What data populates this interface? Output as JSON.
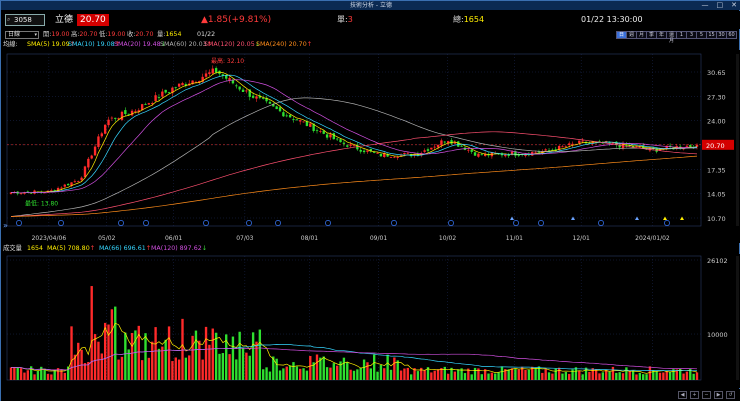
{
  "window": {
    "title": "技術分析 - 立德",
    "controls": [
      "—",
      "□",
      "✕"
    ]
  },
  "header": {
    "code": "3058",
    "name": "立德",
    "price": "20.70",
    "change": "▲1.85(+9.81%)",
    "unit_label": "單:",
    "unit_value": "3",
    "total_label": "總:",
    "total_value": "1654",
    "datetime": "01/22 13:30:00"
  },
  "ohlc": {
    "period": "日線",
    "open_label": "開:",
    "open": "19.00",
    "high_label": "高:",
    "high": "20.70",
    "low_label": "低:",
    "low": "19.00",
    "close_label": "收:",
    "close": "20.70",
    "vol_label": "量:",
    "vol": "1654",
    "date": "01/22"
  },
  "period_buttons": [
    "日",
    "週",
    "月",
    "季",
    "年",
    "還月",
    "1",
    "3",
    "5",
    "15",
    "30",
    "60"
  ],
  "ma_legend": {
    "label": "均線:",
    "items": [
      {
        "text": "SMA(5) 19.09",
        "arrow": "↑",
        "color": "#ffee00"
      },
      {
        "text": "SMA(10) 19.08",
        "arrow": "↑",
        "color": "#36d6ff"
      },
      {
        "text": "SMA(20) 19.48",
        "arrow": "↓",
        "color": "#d04fe0"
      },
      {
        "text": "SMA(60) 20.03",
        "arrow": "↑",
        "color": "#b0b0b0"
      },
      {
        "text": "SMA(120) 20.05",
        "arrow": "↓",
        "color": "#ff5070"
      },
      {
        "text": "SMA(240) 20.70",
        "arrow": "↑",
        "color": "#ff8c1a"
      }
    ]
  },
  "vol_legend": {
    "label": "成交量",
    "value": "1654",
    "items": [
      {
        "text": "MA(5) 708.80",
        "arrow": "↑",
        "color": "#ffee00"
      },
      {
        "text": "MA(66) 696.61",
        "arrow": "↑",
        "color": "#36d6ff"
      },
      {
        "text": "MA(120) 897.62",
        "arrow": "↓",
        "color": "#d04fe0"
      }
    ]
  },
  "chart_data": [
    {
      "type": "candlestick",
      "title": "",
      "y_ticks": [
        "30.65",
        "27.30",
        "24.00",
        "20.70",
        "17.35",
        "14.05",
        "10.70"
      ],
      "ylim": [
        10.7,
        30.65
      ],
      "x_ticks": [
        "2023/04/06",
        "05/02",
        "06/01",
        "07/03",
        "08/01",
        "09/01",
        "10/02",
        "11/01",
        "12/01",
        "2024/01/02"
      ],
      "annotations": {
        "high": "最高: 32.10",
        "low": "最低: 13.80"
      },
      "current_price": 20.7,
      "series_key_points": [
        {
          "x": "2023/03/20",
          "close": 14.2
        },
        {
          "x": "2023/04/06",
          "close": 14.3
        },
        {
          "x": "2023/04/20",
          "close": 16.0
        },
        {
          "x": "2023/05/02",
          "close": 24.0
        },
        {
          "x": "2023/05/15",
          "close": 25.5
        },
        {
          "x": "2023/06/01",
          "close": 28.5
        },
        {
          "x": "2023/06/20",
          "close": 30.8
        },
        {
          "x": "2023/07/03",
          "close": 28.0
        },
        {
          "x": "2023/07/17",
          "close": 25.5
        },
        {
          "x": "2023/08/01",
          "close": 23.3
        },
        {
          "x": "2023/08/15",
          "close": 21.0
        },
        {
          "x": "2023/09/01",
          "close": 19.3
        },
        {
          "x": "2023/09/18",
          "close": 19.4
        },
        {
          "x": "2023/10/02",
          "close": 21.5
        },
        {
          "x": "2023/10/16",
          "close": 19.3
        },
        {
          "x": "2023/11/01",
          "close": 19.5
        },
        {
          "x": "2023/11/15",
          "close": 19.8
        },
        {
          "x": "2023/12/01",
          "close": 21.0
        },
        {
          "x": "2023/12/15",
          "close": 20.8
        },
        {
          "x": "2024/01/02",
          "close": 20.0
        },
        {
          "x": "2024/01/22",
          "close": 20.7
        }
      ]
    },
    {
      "type": "bar",
      "title": "",
      "y_ticks": [
        "26102",
        "10000"
      ],
      "ylim": [
        0,
        26102
      ],
      "last_value": 1654,
      "peaks": [
        {
          "x": "2023/04/25",
          "value": 20500
        },
        {
          "x": "2023/05/05",
          "value": 18000
        },
        {
          "x": "2023/06/05",
          "value": 15000
        }
      ]
    }
  ]
}
